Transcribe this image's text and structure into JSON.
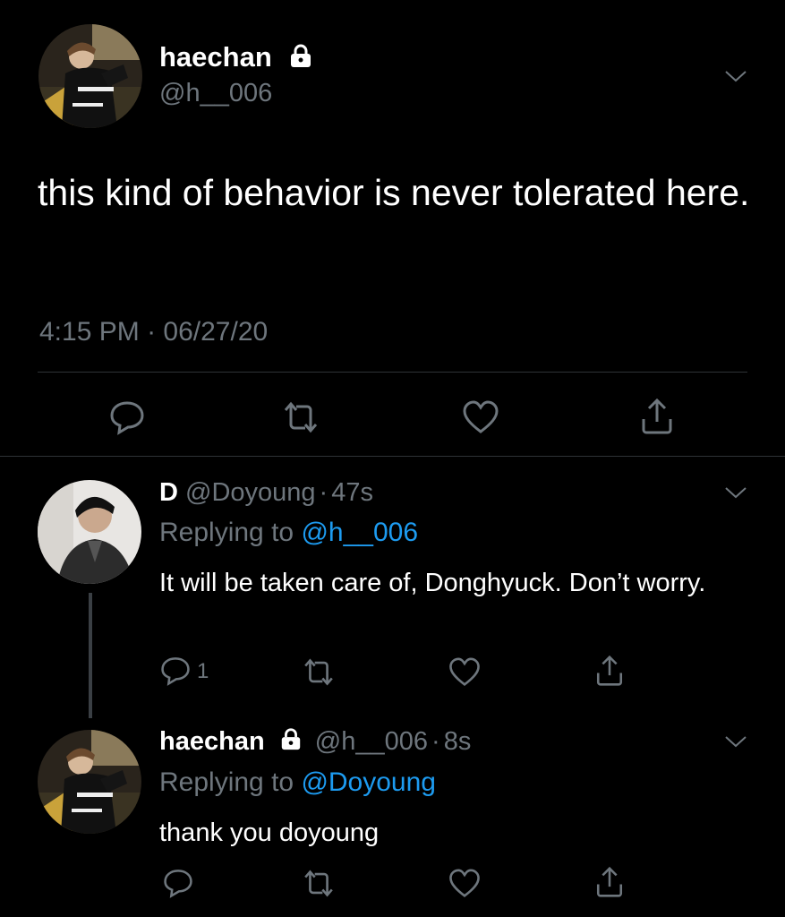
{
  "main_tweet": {
    "display_name": "haechan",
    "handle": "@h__006",
    "text": "this kind of behavior is never tolerated here.",
    "time": "4:15 PM",
    "sep": "·",
    "date": "06/27/20"
  },
  "reply1": {
    "display_name": "D",
    "handle": "@Doyoung",
    "sep": "·",
    "age": "47s",
    "replying_prefix": "Replying to",
    "replying_to": "@h__006",
    "text": "It will be taken care of, Donghyuck. Don’t worry.",
    "reply_count": "1"
  },
  "reply2": {
    "display_name": "haechan",
    "handle": "@h__006",
    "sep": "·",
    "age": "8s",
    "replying_prefix": "Replying to",
    "replying_to": "@Doyoung",
    "text": "thank you doyoung"
  },
  "colors": {
    "background": "#000000",
    "muted": "#6e767d",
    "link": "#1d9bf0",
    "divider": "#2f3336"
  },
  "icons": [
    "lock-icon",
    "chevron-down-icon",
    "reply-icon",
    "retweet-icon",
    "like-icon",
    "share-icon"
  ]
}
